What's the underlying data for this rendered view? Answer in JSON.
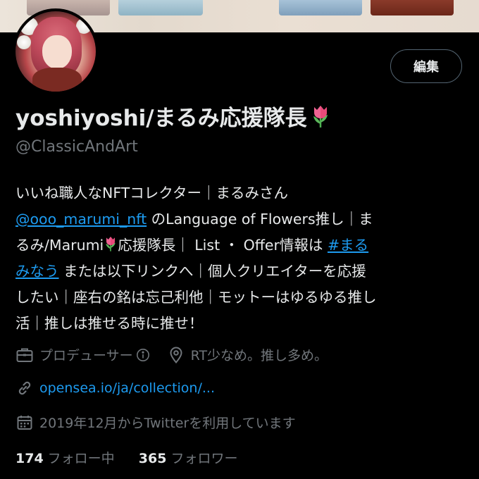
{
  "profile": {
    "edit_label": "編集",
    "display_name": "yoshiyoshi/まるみ応援隊長",
    "handle": "@ClassicAndArt",
    "bio": {
      "l1": "いいね職人なNFTコレクター｜まるみさん",
      "l2_link": "@ooo_marumi_nft",
      "l2_rest": " のLanguage of Flowers推し｜ま",
      "l3_a": "るみ/Marumi",
      "l3_b": "応援隊長｜ List ・ Offer情報は ",
      "l3_link": "#まる",
      "l4_link": "みなう",
      "l4_rest": " または以下リンクへ｜個人クリエイターを応援",
      "l5": "したい｜座右の銘は忘己利他｜モットーはゆるゆる推し",
      "l6": "活｜推しは推せる時に推せ！"
    },
    "category": "プロデューサー",
    "location": "RT少なめ。推し多め。",
    "website": "opensea.io/ja/collection/...",
    "joined": "2019年12月からTwitterを利用しています",
    "following_count": "174",
    "following_label": "フォロー中",
    "followers_count": "365",
    "followers_label": "フォロワー"
  },
  "colors": {
    "background": "#000000",
    "text": "#e7e9ea",
    "muted": "#71767b",
    "accent": "#1d9bf0",
    "button_border": "#536471"
  },
  "icons": [
    "briefcase-icon",
    "info-icon",
    "location-pin-icon",
    "link-icon",
    "calendar-icon",
    "tulip-emoji"
  ]
}
